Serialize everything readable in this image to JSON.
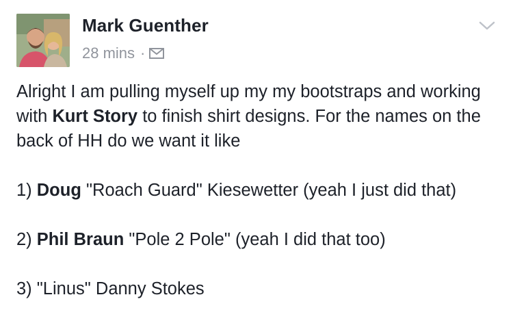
{
  "post": {
    "author": "Mark Guenther",
    "timestamp": "28 mins",
    "separator": "·",
    "audience_icon": "envelope-icon",
    "menu_icon": "chevron-down-icon",
    "avatar_icon": "profile-photo"
  },
  "body": {
    "p1_a": "Alright I am pulling myself up my my bootstraps and working with ",
    "p1_tag": "Kurt Story",
    "p1_b": " to finish shirt designs. For the names on the back of HH do we want it like",
    "item1_num": "1) ",
    "item1_tag": "Doug",
    "item1_rest": " \"Roach Guard\" Kiesewetter (yeah I just did that)",
    "item2_num": "2) ",
    "item2_tag": "Phil Braun",
    "item2_rest": " \"Pole 2 Pole\" (yeah I did that too)",
    "item3_text": "3) \"Linus\" Danny Stokes"
  }
}
